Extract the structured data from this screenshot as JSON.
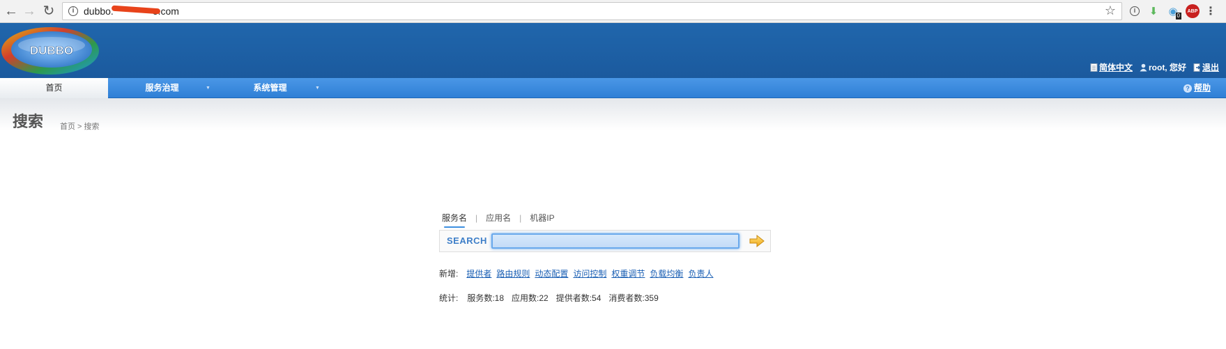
{
  "browser": {
    "url": "dubbo.",
    "url_suffix": "o.com",
    "extension_badge": "0",
    "abp_label": "ABP"
  },
  "header": {
    "logo_text": "DUBBO",
    "language_link": "简体中文",
    "user_greeting": "root, 您好",
    "logout_link": "退出"
  },
  "menu": {
    "home": "首页",
    "service_governance": "服务治理",
    "system_management": "系统管理",
    "help": "帮助"
  },
  "page": {
    "title": "搜索",
    "breadcrumb": "首页 > 搜索"
  },
  "search": {
    "tabs": [
      "服务名",
      "应用名",
      "机器IP"
    ],
    "active_tab": 0,
    "label": "SEARCH",
    "value": ""
  },
  "new_links": {
    "label": "新增:",
    "items": [
      "提供者",
      "路由规则",
      "动态配置",
      "访问控制",
      "权重调节",
      "负载均衡",
      "负责人"
    ]
  },
  "stats": {
    "label": "统计:",
    "items": [
      "服务数:18",
      "应用数:22",
      "提供者数:54",
      "消费者数:359"
    ]
  },
  "colors": {
    "header_blue": "#1f62a8",
    "menu_blue": "#3b8ae0",
    "link_blue": "#1a5fb4"
  }
}
